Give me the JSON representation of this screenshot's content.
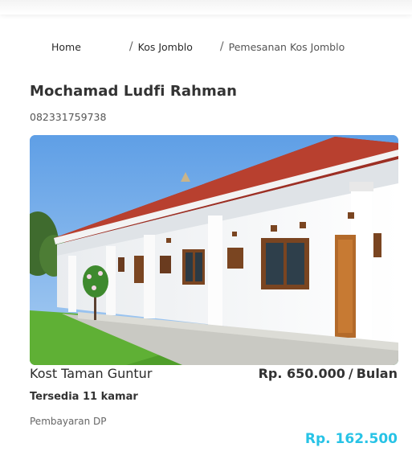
{
  "breadcrumb": {
    "home": "Home",
    "separator": "/",
    "kos": "Kos Jomblo",
    "current": "Pemesanan Kos Jomblo"
  },
  "user": {
    "name": "Mochamad Ludfi Rahman",
    "phone": "082331759738"
  },
  "kost": {
    "name": "Kost Taman Guntur",
    "price": "Rp. 650.000",
    "price_unit": "Bulan",
    "availability": "Tersedia 11 kamar",
    "payment_label": "Pembayaran DP",
    "dp_amount": "Rp. 162.500"
  },
  "colors": {
    "accent": "#27c3e6",
    "text": "#2b2b2b"
  }
}
